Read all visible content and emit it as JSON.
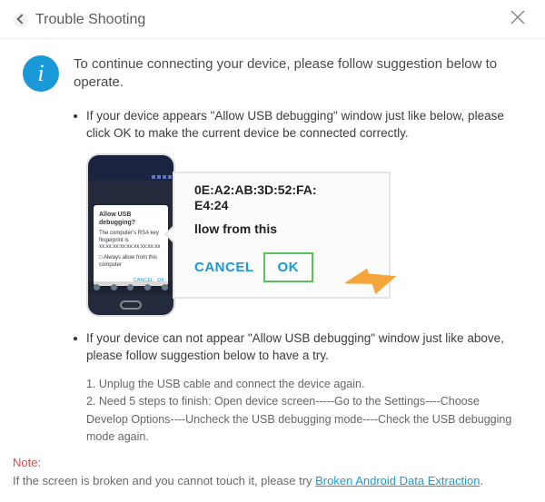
{
  "titlebar": {
    "title": "Trouble Shooting"
  },
  "lead": "To continue connecting your device, please follow suggestion below to operate.",
  "item1": {
    "text": "If your device appears \"Allow USB debugging\" window just like below, please click OK to make the current device  be connected correctly."
  },
  "phone_dialog": {
    "title": "Allow USB debugging?",
    "body1": "The computer's RSA key fingerprint is",
    "body2": "xx:xx:xx:xx:xx:xx:xx:xx:xx",
    "opt": "□ Always allow from this computer",
    "cancel": "CANCEL",
    "ok": "OK"
  },
  "callout": {
    "line1": "0E:A2:AB:3D:52:FA:",
    "line2": "E4:24",
    "prompt": "llow from this",
    "cancel": "CANCEL",
    "ok": "OK"
  },
  "item2": {
    "text": "If your device can not appear \"Allow USB debugging\" window just like above, please follow suggestion below to have a try.",
    "step1": "1. Unplug the USB cable and connect the device again.",
    "step2": "2. Need 5 steps to finish: Open device screen-----Go to the Settings----Choose Develop Options----Uncheck the USB debugging mode----Check the USB debugging mode again."
  },
  "note": {
    "label": "Note:",
    "text": "If the screen is broken and you cannot touch it, please try ",
    "link": "Broken Android Data Extraction",
    "tail": "."
  }
}
